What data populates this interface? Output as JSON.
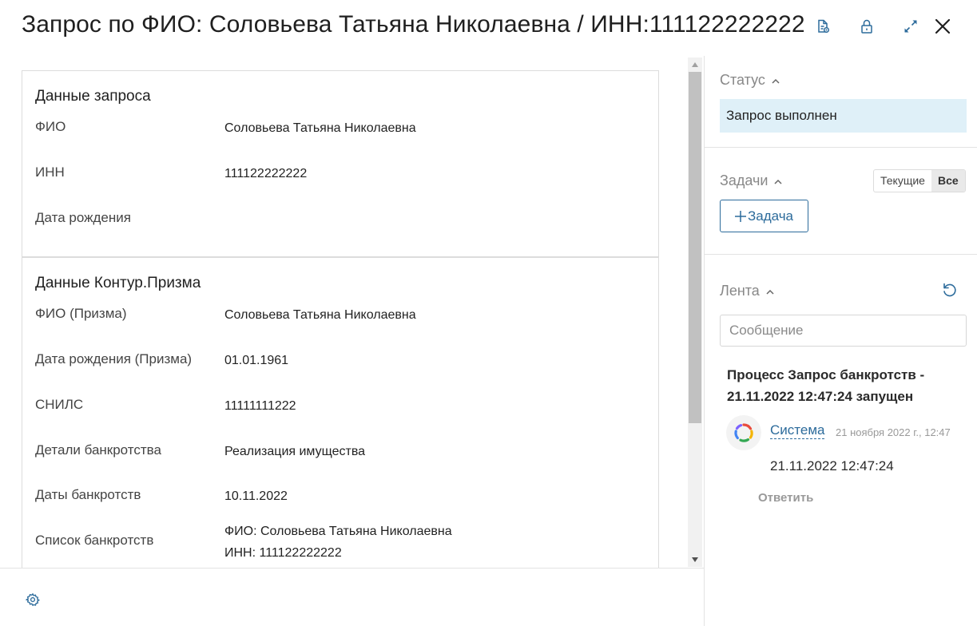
{
  "header": {
    "title": "Запрос по ФИО: Соловьева Татьяна Николаевна / ИНН:111122222222"
  },
  "icons": {
    "document": "document-icon",
    "lock": "lock-icon",
    "expand": "expand-icon",
    "close": "close-icon",
    "settings": "gear-icon",
    "refresh": "refresh-icon"
  },
  "request_card": {
    "title": "Данные запроса",
    "rows": [
      {
        "label": "ФИО",
        "value": "Соловьева Татьяна Николаевна"
      },
      {
        "label": "ИНН",
        "value": "111122222222"
      },
      {
        "label": "Дата рождения",
        "value": ""
      }
    ]
  },
  "prizma_card": {
    "title": "Данные Контур.Призма",
    "rows": [
      {
        "label": "ФИО (Призма)",
        "value": "Соловьева Татьяна Николаевна"
      },
      {
        "label": "Дата рождения (Призма)",
        "value": "01.01.1961"
      },
      {
        "label": "СНИЛС",
        "value": "11111111222"
      },
      {
        "label": "Детали банкротства",
        "value": "Реализация имущества"
      },
      {
        "label": "Даты банкротств",
        "value": "10.11.2022"
      },
      {
        "label": "Список банкротств",
        "value_line1": "ФИО: Соловьева Татьяна Николаевна",
        "value_line2": "ИНН: 111122222222"
      }
    ]
  },
  "sidebar": {
    "status": {
      "title": "Статус",
      "value": "Запрос выполнен"
    },
    "tasks": {
      "title": "Задачи",
      "toggle": [
        "Текущие",
        "Все"
      ],
      "active_toggle": "Все",
      "add_button": "Задача"
    },
    "feed": {
      "title": "Лента",
      "input_placeholder": "Сообщение",
      "entry": {
        "title": "Процесс Запрос банкротств - 21.11.2022 12:47:24 запущен",
        "author": "Система",
        "time": "21 ноября 2022 г., 12:47",
        "text": "21.11.2022 12:47:24",
        "reply": "Ответить"
      }
    }
  },
  "colors": {
    "accent": "#2c6b9b",
    "status_bg": "#dff0f8"
  }
}
